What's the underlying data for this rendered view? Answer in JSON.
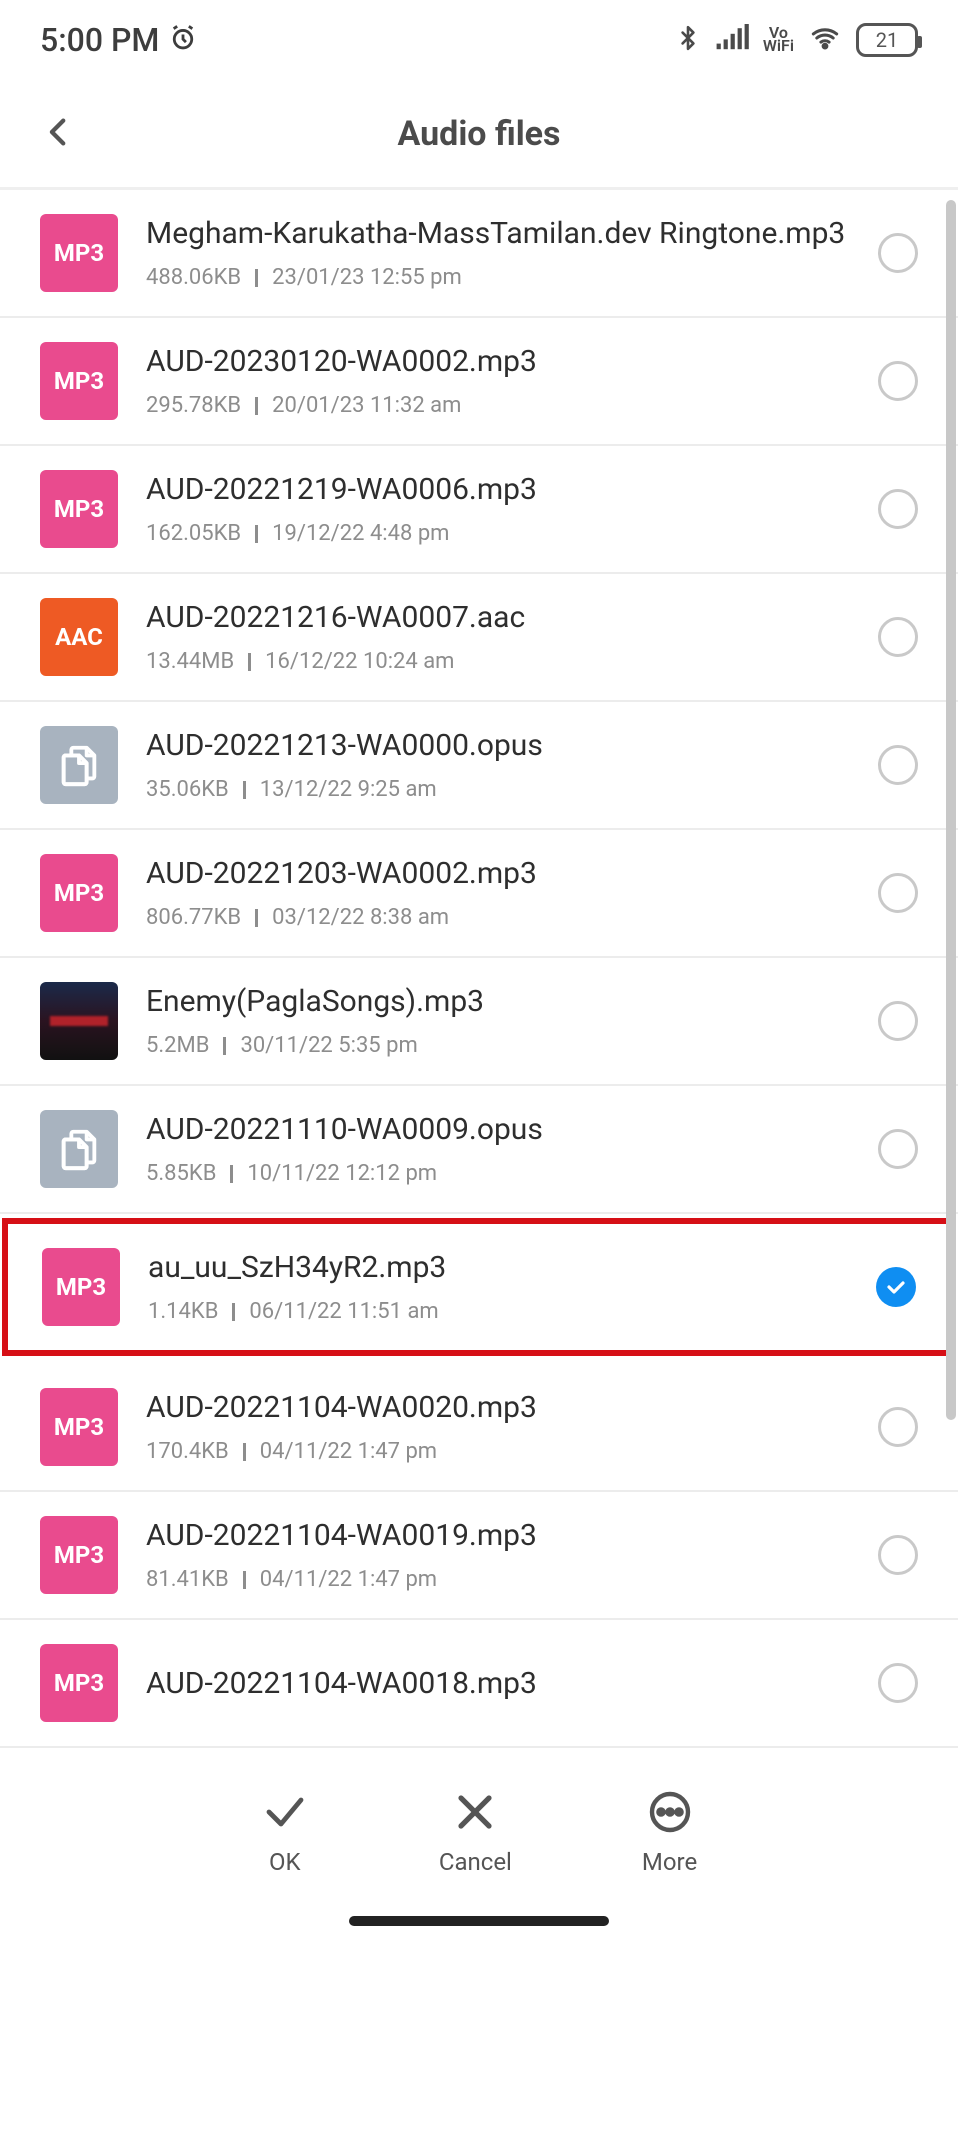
{
  "status": {
    "time": "5:00 PM",
    "battery": "21",
    "vo": "Vo",
    "wifi_label": "WiFi"
  },
  "header": {
    "title": "Audio files"
  },
  "files": [
    {
      "name": "Megham-Karukatha-MassTamilan.dev Ringtone.mp3",
      "size": "488.06KB",
      "date": "23/01/23 12:55 pm",
      "type": "mp3",
      "selected": false,
      "highlighted": false
    },
    {
      "name": "AUD-20230120-WA0002.mp3",
      "size": "295.78KB",
      "date": "20/01/23 11:32 am",
      "type": "mp3",
      "selected": false,
      "highlighted": false
    },
    {
      "name": "AUD-20221219-WA0006.mp3",
      "size": "162.05KB",
      "date": "19/12/22 4:48 pm",
      "type": "mp3",
      "selected": false,
      "highlighted": false
    },
    {
      "name": "AUD-20221216-WA0007.aac",
      "size": "13.44MB",
      "date": "16/12/22 10:24 am",
      "type": "aac",
      "selected": false,
      "highlighted": false
    },
    {
      "name": "AUD-20221213-WA0000.opus",
      "size": "35.06KB",
      "date": "13/12/22 9:25 am",
      "type": "opus",
      "selected": false,
      "highlighted": false
    },
    {
      "name": "AUD-20221203-WA0002.mp3",
      "size": "806.77KB",
      "date": "03/12/22 8:38 am",
      "type": "mp3",
      "selected": false,
      "highlighted": false
    },
    {
      "name": "Enemy(PaglaSongs).mp3",
      "size": "5.2MB",
      "date": "30/11/22 5:35 pm",
      "type": "art",
      "selected": false,
      "highlighted": false
    },
    {
      "name": "AUD-20221110-WA0009.opus",
      "size": "5.85KB",
      "date": "10/11/22 12:12 pm",
      "type": "opus",
      "selected": false,
      "highlighted": false
    },
    {
      "name": "au_uu_SzH34yR2.mp3",
      "size": "1.14KB",
      "date": "06/11/22 11:51 am",
      "type": "mp3",
      "selected": true,
      "highlighted": true
    },
    {
      "name": "AUD-20221104-WA0020.mp3",
      "size": "170.4KB",
      "date": "04/11/22 1:47 pm",
      "type": "mp3",
      "selected": false,
      "highlighted": false
    },
    {
      "name": "AUD-20221104-WA0019.mp3",
      "size": "81.41KB",
      "date": "04/11/22 1:47 pm",
      "type": "mp3",
      "selected": false,
      "highlighted": false
    },
    {
      "name": "AUD-20221104-WA0018.mp3",
      "size": "",
      "date": "",
      "type": "mp3",
      "selected": false,
      "highlighted": false
    }
  ],
  "bottom": {
    "ok": "OK",
    "cancel": "Cancel",
    "more": "More"
  },
  "thumb_labels": {
    "mp3": "MP3",
    "aac": "AAC",
    "opus": "",
    "art": ""
  }
}
